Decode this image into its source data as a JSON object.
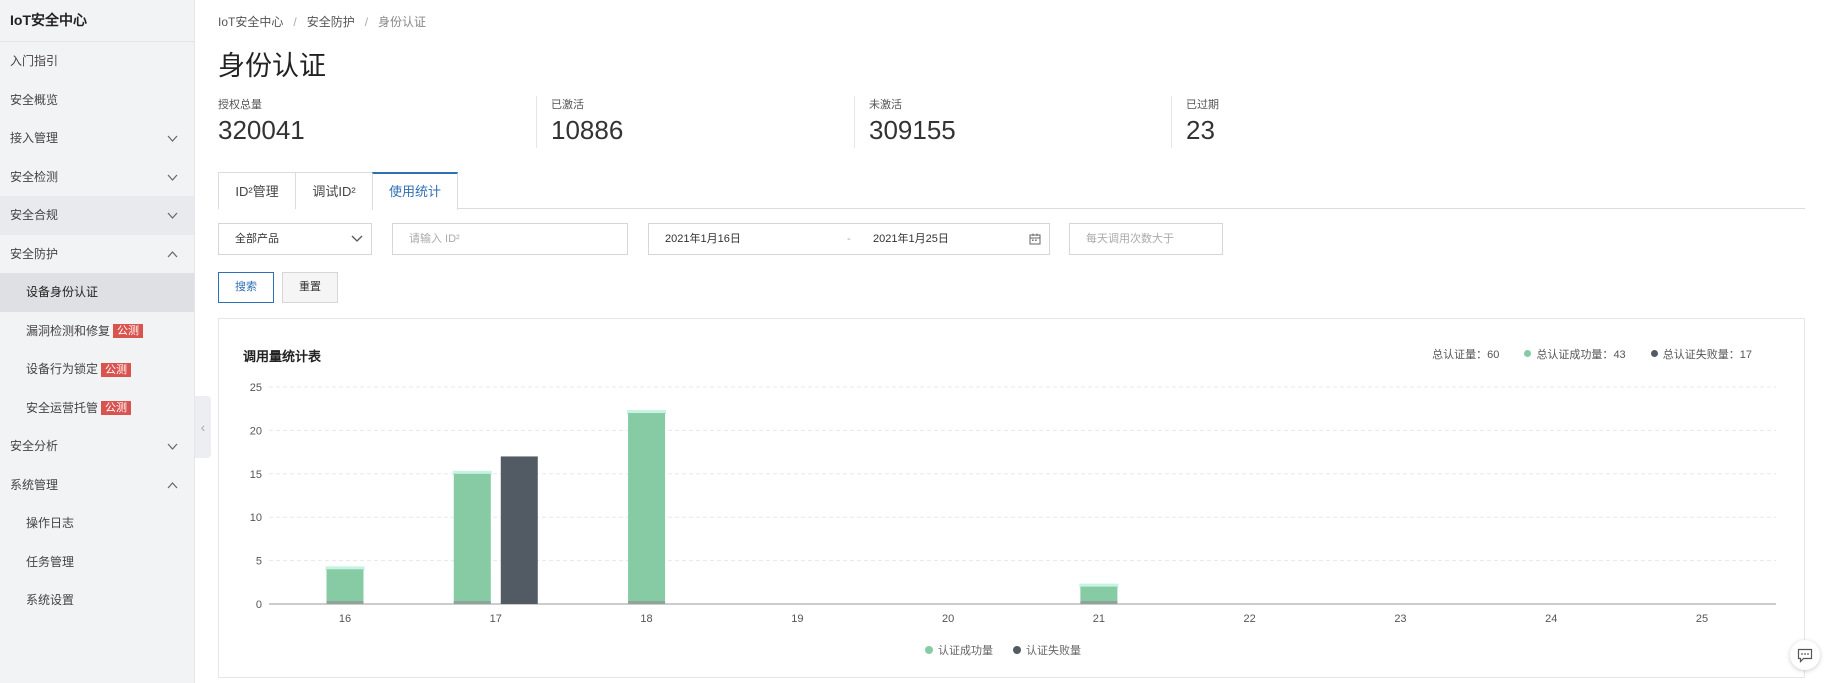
{
  "app": {
    "title": "IoT安全中心"
  },
  "sidebar": {
    "items": [
      {
        "label": "入门指引",
        "level": 1,
        "chevron": ""
      },
      {
        "label": "安全概览",
        "level": 1,
        "chevron": ""
      },
      {
        "label": "接入管理",
        "level": 1,
        "chevron": "down"
      },
      {
        "label": "安全检测",
        "level": 1,
        "chevron": "down"
      },
      {
        "label": "安全合规",
        "level": 1,
        "chevron": "down",
        "highlight": true
      },
      {
        "label": "安全防护",
        "level": 1,
        "chevron": "up"
      },
      {
        "label": "设备身份认证",
        "level": 2,
        "active": true
      },
      {
        "label": "漏洞检测和修复",
        "level": 2,
        "badge": "公测"
      },
      {
        "label": "设备行为锁定",
        "level": 2,
        "badge": "公测"
      },
      {
        "label": "安全运营托管",
        "level": 2,
        "badge": "公测"
      },
      {
        "label": "安全分析",
        "level": 1,
        "chevron": "down"
      },
      {
        "label": "系统管理",
        "level": 1,
        "chevron": "up"
      },
      {
        "label": "操作日志",
        "level": 2
      },
      {
        "label": "任务管理",
        "level": 2
      },
      {
        "label": "系统设置",
        "level": 2
      }
    ]
  },
  "breadcrumb": [
    "IoT安全中心",
    "安全防护",
    "身份认证"
  ],
  "page": {
    "title": "身份认证"
  },
  "stats": [
    {
      "label": "授权总量",
      "value": "320041"
    },
    {
      "label": "已激活",
      "value": "10886"
    },
    {
      "label": "未激活",
      "value": "309155"
    },
    {
      "label": "已过期",
      "value": "23"
    }
  ],
  "tabs": [
    {
      "label": "ID²管理"
    },
    {
      "label": "调试ID²"
    },
    {
      "label": "使用统计",
      "active": true
    }
  ],
  "filters": {
    "product": "全部产品",
    "id_placeholder": "请输入 ID²",
    "date_start": "2021年1月16日",
    "date_sep": "-",
    "date_end": "2021年1月25日",
    "calls_placeholder": "每天调用次数大于"
  },
  "buttons": {
    "search": "搜索",
    "reset": "重置"
  },
  "chart_panel": {
    "title": "调用量统计表",
    "summary": {
      "total_label": "总认证量：",
      "total": "60",
      "success_label": "总认证成功量：",
      "success": "43",
      "fail_label": "总认证失败量：",
      "fail": "17"
    }
  },
  "colors": {
    "success": "#86cba4",
    "fail": "#525b63",
    "accent": "#2f6fb5",
    "badge": "#d9534f"
  },
  "chart_data": {
    "type": "bar",
    "title": "调用量统计表",
    "categories": [
      "16",
      "17",
      "18",
      "19",
      "20",
      "21",
      "22",
      "23",
      "24",
      "25"
    ],
    "series": [
      {
        "name": "认证成功量",
        "values": [
          4,
          15,
          22,
          0,
          0,
          2,
          0,
          0,
          0,
          0
        ],
        "color": "#86cba4"
      },
      {
        "name": "认证失败量",
        "values": [
          0,
          17,
          0,
          0,
          0,
          0,
          0,
          0,
          0,
          0
        ],
        "color": "#525b63"
      }
    ],
    "yticks": [
      0,
      5,
      10,
      15,
      20,
      25
    ],
    "ylim": [
      0,
      25
    ],
    "grid": true,
    "legend": "bottom-center"
  }
}
